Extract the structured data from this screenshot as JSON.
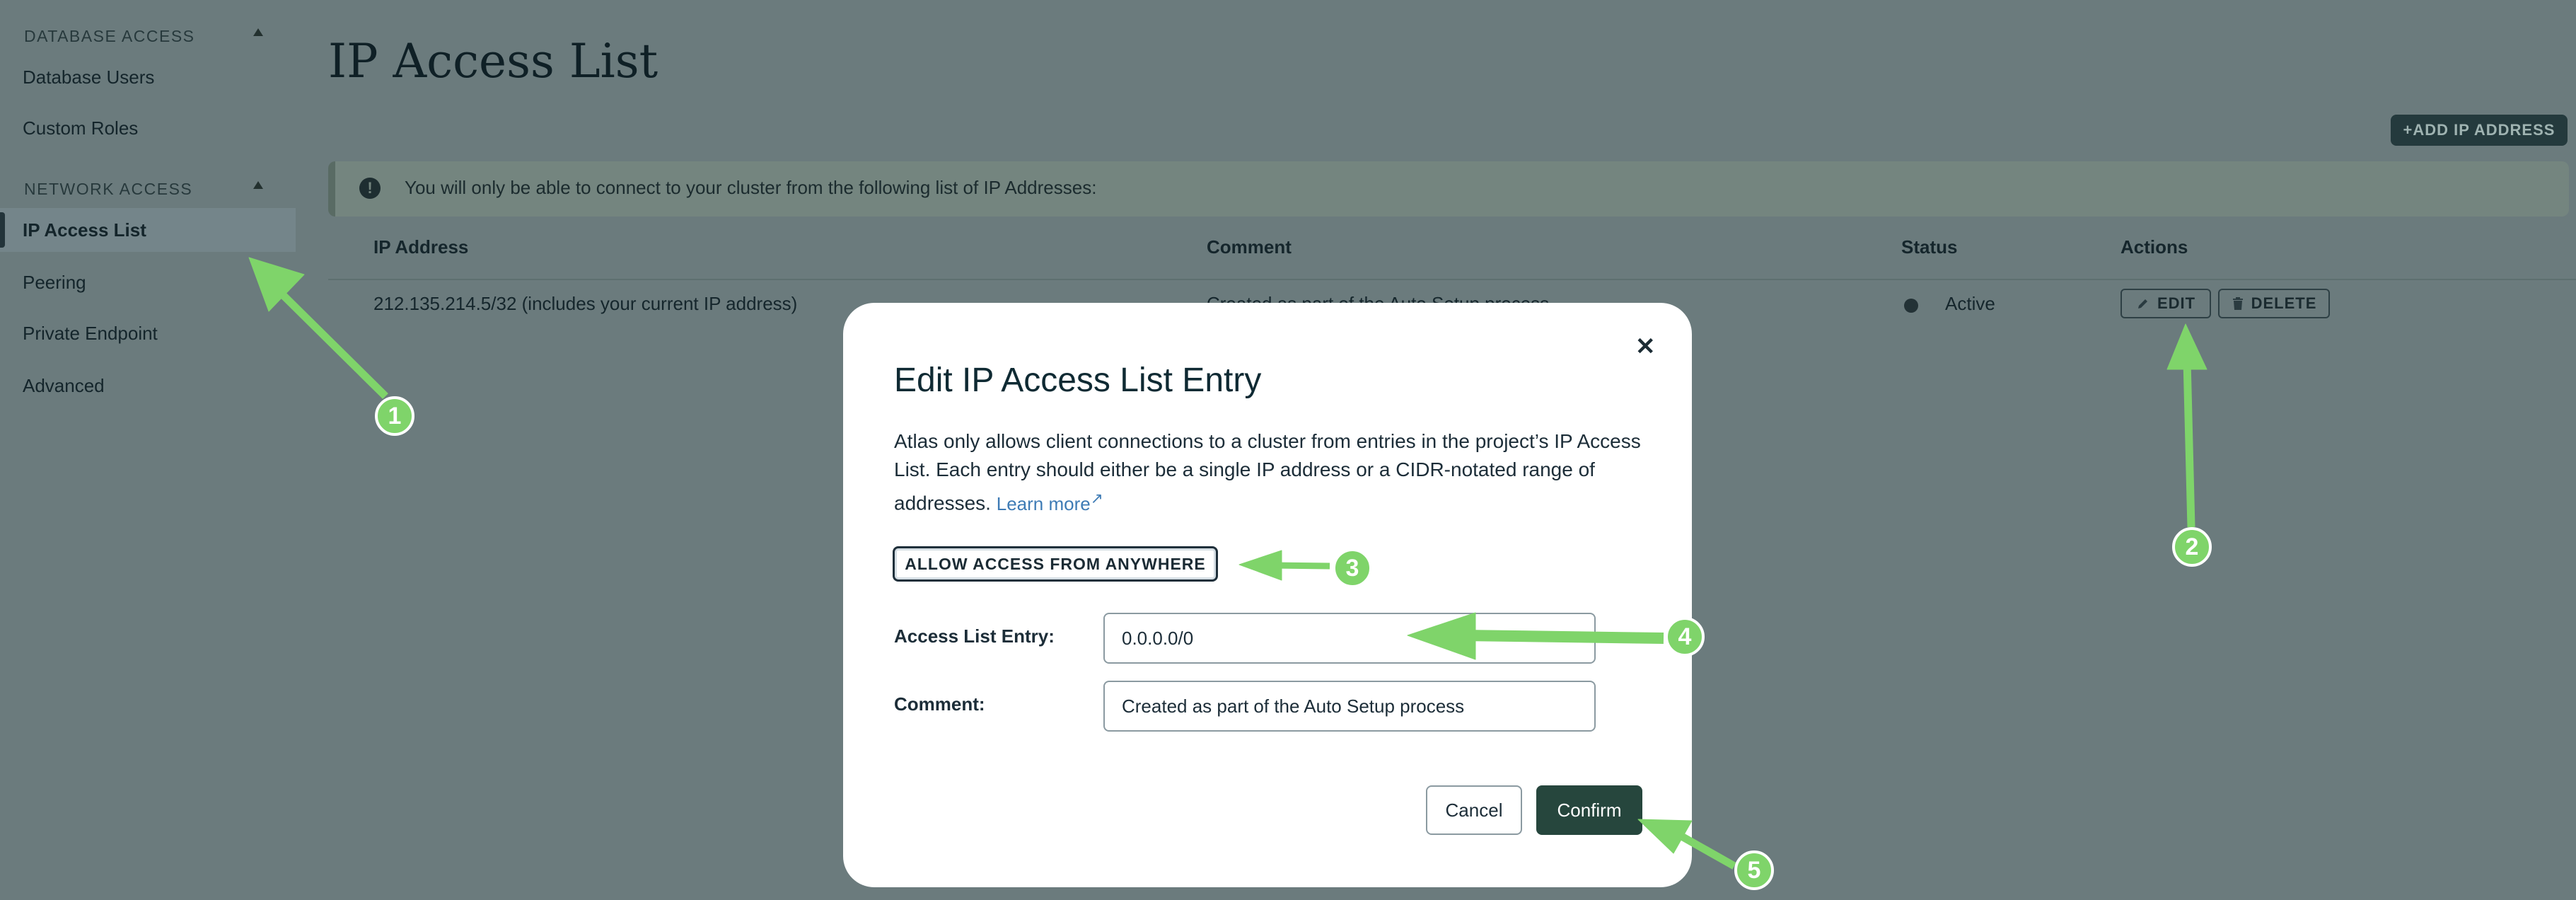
{
  "sidebar": {
    "database_access": "DATABASE ACCESS",
    "db_items": [
      "Database Users",
      "Custom Roles"
    ],
    "network_access": "NETWORK ACCESS",
    "net_items": [
      "IP Access List",
      "Peering",
      "Private Endpoint",
      "Advanced"
    ]
  },
  "page": {
    "title": "IP Access List",
    "add_button": "+ADD IP ADDRESS",
    "banner": "You will only be able to connect to your cluster from the following list of IP Addresses:"
  },
  "table": {
    "headers": [
      "IP Address",
      "Comment",
      "Status",
      "Actions"
    ],
    "row": {
      "ip": "212.135.214.5/32  (includes your current IP address)",
      "comment": "Created as part of the Auto Setup process",
      "status": "Active",
      "edit": "EDIT",
      "delete": "DELETE"
    }
  },
  "modal": {
    "title": "Edit IP Access List Entry",
    "description": "Atlas only allows client connections to a cluster from entries in the project’s IP Access List. Each entry should either be a single IP address or a CIDR-notated range of addresses.",
    "learn_more": "Learn more",
    "allow_anywhere": "ALLOW ACCESS FROM ANYWHERE",
    "entry_label": "Access List Entry:",
    "entry_value": "0.0.0.0/0",
    "comment_label": "Comment:",
    "comment_value": "Created as part of the Auto Setup process",
    "cancel": "Cancel",
    "confirm": "Confirm"
  },
  "callouts": [
    "1",
    "2",
    "3",
    "4",
    "5"
  ],
  "colors": {
    "overlay": "#6b7b7d",
    "arrow": "#7fd46a",
    "confirm": "#26463d"
  }
}
